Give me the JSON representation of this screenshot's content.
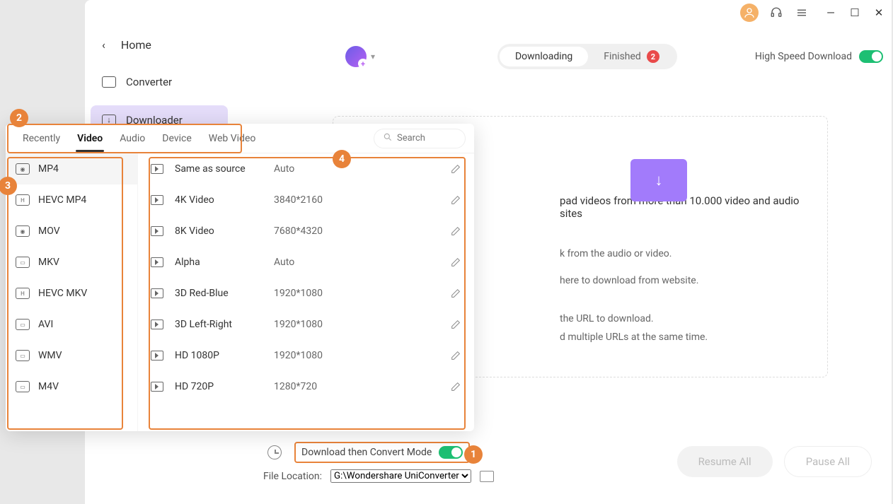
{
  "titlebar": {},
  "sidebar": {
    "back_label": "Home",
    "items": [
      {
        "label": "Converter"
      },
      {
        "label": "Downloader"
      }
    ]
  },
  "main": {
    "tabs": {
      "downloading": "Downloading",
      "finished": "Finished",
      "finished_badge": "2"
    },
    "high_speed_label": "High Speed Download"
  },
  "convert_mode_label": "Download then Convert Mode",
  "file_location": {
    "label": "File Location:",
    "value": "G:\\Wondershare UniConverter"
  },
  "actions": {
    "resume": "Resume All",
    "pause": "Pause All"
  },
  "drop": {
    "line1": "pad videos from more than 10.000 video and audio sites",
    "line2": "k from the audio or video.",
    "line3": "here to download from website.",
    "line4": "the URL to download.",
    "line5": "d multiple URLs at the same time."
  },
  "popup": {
    "tabs": [
      "Recently",
      "Video",
      "Audio",
      "Device",
      "Web Video"
    ],
    "active_tab_index": 1,
    "search_placeholder": "Search",
    "formats": [
      "MP4",
      "HEVC MP4",
      "MOV",
      "MKV",
      "HEVC MKV",
      "AVI",
      "WMV",
      "M4V"
    ],
    "active_format_index": 0,
    "resolutions": [
      {
        "name": "Same as source",
        "dim": "Auto"
      },
      {
        "name": "4K Video",
        "dim": "3840*2160"
      },
      {
        "name": "8K Video",
        "dim": "7680*4320"
      },
      {
        "name": "Alpha",
        "dim": "Auto"
      },
      {
        "name": "3D Red-Blue",
        "dim": "1920*1080"
      },
      {
        "name": "3D Left-Right",
        "dim": "1920*1080"
      },
      {
        "name": "HD 1080P",
        "dim": "1920*1080"
      },
      {
        "name": "HD 720P",
        "dim": "1280*720"
      }
    ]
  },
  "annotations": {
    "b1": "1",
    "b2": "2",
    "b3": "3",
    "b4": "4"
  }
}
